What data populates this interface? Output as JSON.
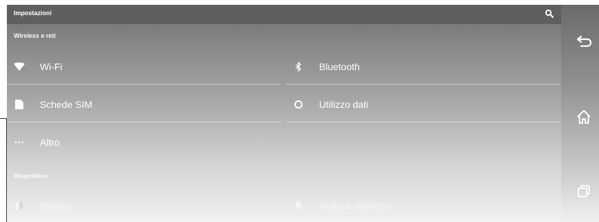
{
  "appbar": {
    "title": "Impostazioni",
    "search_icon": "search-icon"
  },
  "sections": {
    "wireless": "Wireless e reti",
    "device": "Dispositivo"
  },
  "items": {
    "wifi": "Wi-Fi",
    "bluetooth": "Bluetooth",
    "sim": "Schede SIM",
    "data_usage": "Utilizzo dati",
    "more": "Altro",
    "display": "Display",
    "audio": "Audio e notifiche"
  },
  "navbar": {
    "back": "back-icon",
    "home": "home-icon",
    "recents": "recents-icon"
  }
}
